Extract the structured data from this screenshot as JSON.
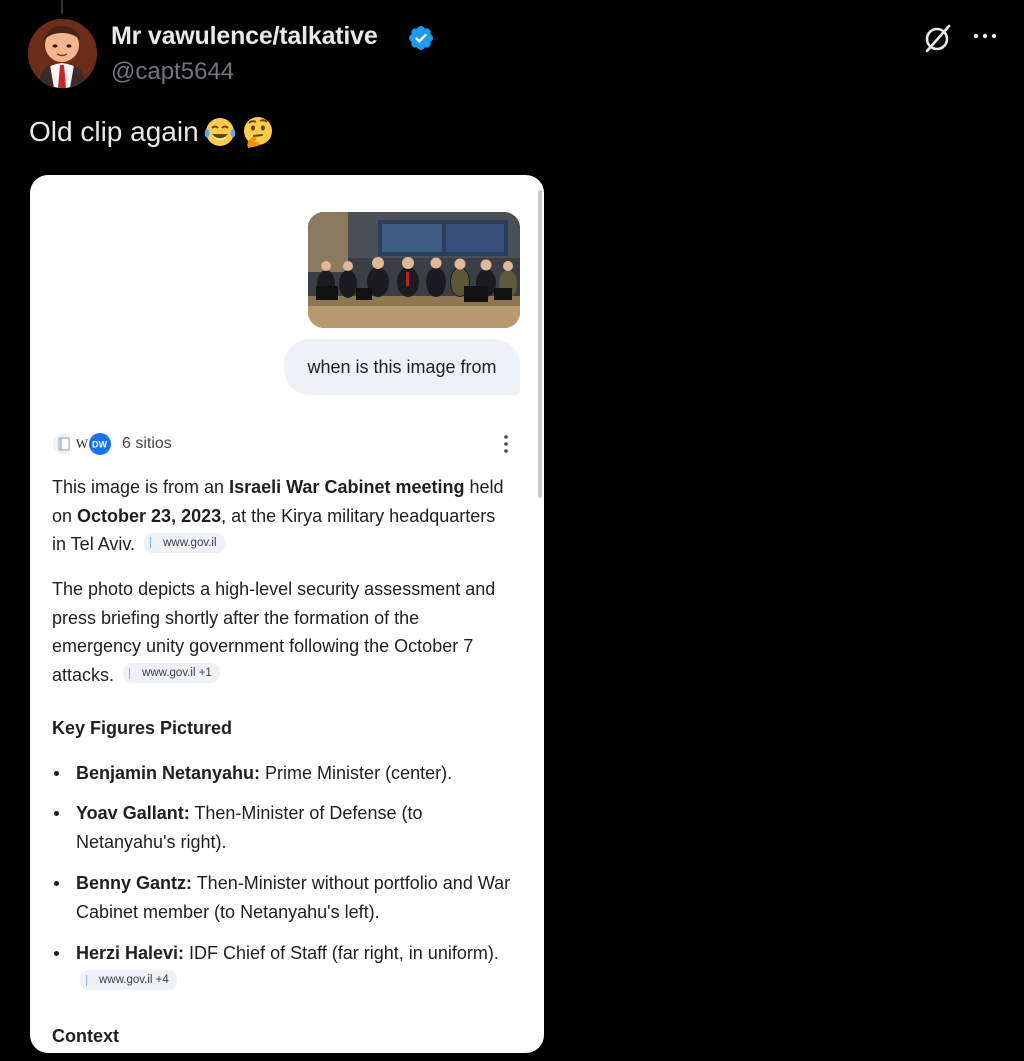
{
  "author": {
    "display_name": "Mr vawulence/talkative",
    "handle": "@capt5644",
    "verified": true
  },
  "tweet": {
    "text": "Old clip again",
    "emojis": [
      "face-with-tears-of-joy",
      "thinking-face"
    ]
  },
  "icons": {
    "grok": "grok-icon",
    "more": "more-horizontal-icon",
    "verified": "verified-badge-icon"
  },
  "colors": {
    "background": "#000000",
    "verified_blue": "#1d9bf0",
    "handle_gray": "#71767b"
  },
  "screenshot": {
    "user_message": "when is this image from",
    "sources": {
      "count_label": "6 sitios",
      "icons": [
        "page-icon",
        "wikipedia-icon",
        "dw-icon"
      ]
    },
    "paragraph1": {
      "t1": "This image is from an ",
      "b1": "Israeli War Cabinet meeting",
      "t2": " held on ",
      "b2": "October 23, 2023",
      "t3": ", at the Kirya military headquarters in Tel Aviv.",
      "chip": "www.gov.il"
    },
    "paragraph2": {
      "text": "The photo depicts a high-level security assessment and press briefing shortly after the formation of the emergency unity government following the October 7 attacks.",
      "chip": "www.gov.il +1"
    },
    "key_figures_heading": "Key Figures Pictured",
    "key_figures": [
      {
        "name": "Benjamin Netanyahu:",
        "desc": " Prime Minister (center)."
      },
      {
        "name": "Yoav Gallant:",
        "desc": " Then-Minister of Defense (to Netanyahu's right)."
      },
      {
        "name": "Benny Gantz:",
        "desc": " Then-Minister without portfolio and War Cabinet member (to Netanyahu's left)."
      },
      {
        "name": "Herzi Halevi:",
        "desc": " IDF Chief of Staff (far right, in uniform).",
        "chip": "www.gov.il +4"
      }
    ],
    "context_heading": "Context"
  }
}
